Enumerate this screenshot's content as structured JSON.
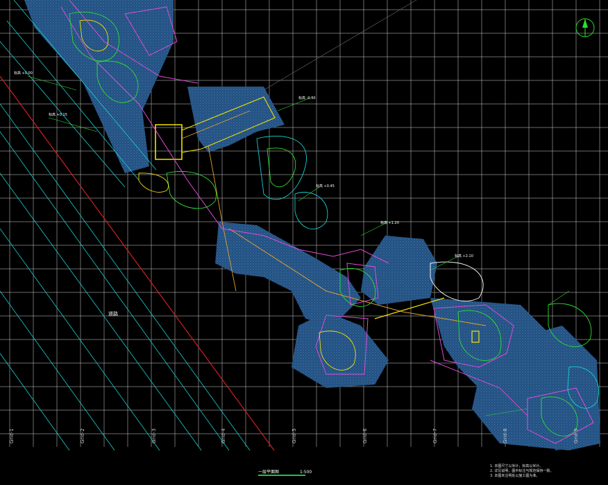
{
  "plan": {
    "title": "一层平面图",
    "scale": "1:500",
    "bottom_tags": [
      "Grid-1",
      "Grid-2",
      "Grid-3",
      "Grid-4",
      "Grid-5",
      "Grid-6",
      "Grid-7",
      "Grid-8",
      "Grid-9"
    ],
    "road_label": "道路",
    "notes": [
      "1. 本图尺寸以米计，标高以米计。",
      "2. 详见说明，图中标注与规范保持一致。",
      "3. 本图未注明处以施工图为准。"
    ],
    "annotations": [
      "标高 +0.00",
      "标高 +0.15",
      "标高 -0.30",
      "标高 +0.45",
      "标高 +1.20",
      "标高 +2.10"
    ],
    "north_arrow_label": "N"
  },
  "colors": {
    "background": "#000000",
    "grid": "#ffffff",
    "hatch": "#2a5f9e",
    "red_line": "#d32020",
    "cyan_line": "#19d0d0",
    "green_line": "#2ce02c",
    "magenta_line": "#e04ad8",
    "yellow_line": "#f2e200",
    "orange_line": "#e2a22c"
  }
}
